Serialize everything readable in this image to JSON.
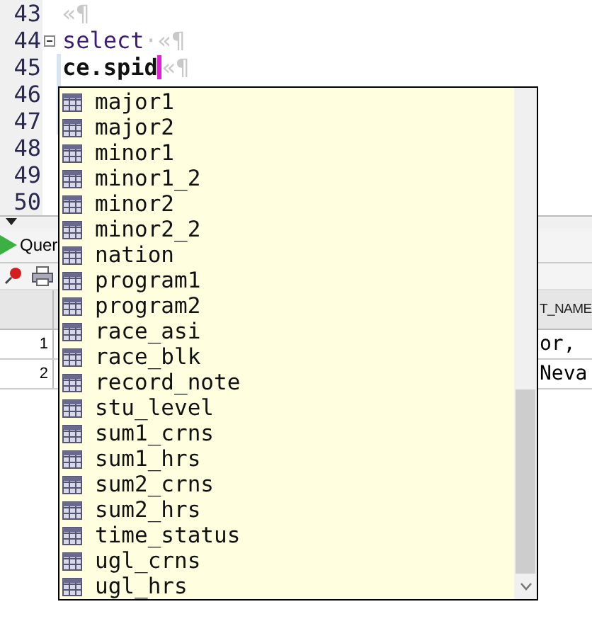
{
  "editor": {
    "lines": [
      {
        "number": "43",
        "foldable": false,
        "changed": false,
        "cursor": false,
        "tokens": [
          {
            "kind": "mark",
            "text": "«¶"
          }
        ]
      },
      {
        "number": "44",
        "foldable": true,
        "changed": false,
        "cursor": false,
        "tokens": [
          {
            "kind": "keyword",
            "text": "select"
          },
          {
            "kind": "mark",
            "text": "·«¶"
          }
        ]
      },
      {
        "number": "45",
        "foldable": false,
        "changed": true,
        "cursor": true,
        "tokens": [
          {
            "kind": "bold",
            "text": "ce.spid"
          },
          {
            "kind": "mark",
            "text": "«¶"
          }
        ]
      },
      {
        "number": "46",
        "foldable": false,
        "changed": true,
        "cursor": false
      },
      {
        "number": "47",
        "foldable": false,
        "changed": true,
        "cursor": false
      },
      {
        "number": "48",
        "foldable": false,
        "changed": false,
        "cursor": false
      },
      {
        "number": "49",
        "foldable": false,
        "changed": false,
        "cursor": false
      },
      {
        "number": "50",
        "foldable": false,
        "changed": false,
        "cursor": false
      }
    ]
  },
  "autocomplete": {
    "items": [
      "major1",
      "major2",
      "minor1",
      "minor1_2",
      "minor2",
      "minor2_2",
      "nation",
      "program1",
      "program2",
      "race_asi",
      "race_blk",
      "record_note",
      "stu_level",
      "sum1_crns",
      "sum1_hrs",
      "sum2_crns",
      "sum2_hrs",
      "time_status",
      "ugl_crns",
      "ugl_hrs"
    ]
  },
  "results": {
    "tab": {
      "label": "Quer"
    },
    "header": "T_NAME",
    "rows": [
      {
        "number": "1",
        "cell": "or,"
      },
      {
        "number": "2",
        "cell": "Neva"
      }
    ]
  }
}
